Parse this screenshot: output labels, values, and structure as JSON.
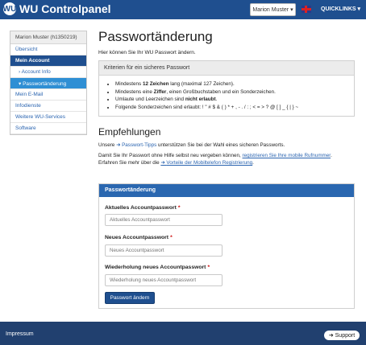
{
  "header": {
    "brand": "WU Controlpanel",
    "brand_logo": "WU",
    "user_menu": "Marion Muster ▾",
    "language_icon": "uk-flag-icon",
    "quicklinks": "QUICKLINKS ▾"
  },
  "sidebar": {
    "heading": "Marion Muster (h1350219)",
    "items": [
      {
        "label": "Übersicht"
      },
      {
        "label": "Mein Account"
      },
      {
        "label": "›  Account Info"
      },
      {
        "label": "▾  Passwortänderung"
      },
      {
        "label": "Mein E-Mail"
      },
      {
        "label": "Infodienste"
      },
      {
        "label": "Weitere WU-Services"
      },
      {
        "label": "Software"
      }
    ]
  },
  "main": {
    "title": "Passwortänderung",
    "intro": "Hier können Sie Ihr WU Passwort ändern.",
    "criteria": {
      "heading": "Kriterien für ein sicheres Passwort",
      "items": [
        {
          "pre": "Mindestens ",
          "bold": "12 Zeichen",
          "post": " lang (maximal 127 Zeichen)."
        },
        {
          "pre": "Mindestens eine ",
          "bold": "Ziffer",
          "post": ", einen Großbuchstaben und ein Sonderzeichen."
        },
        {
          "pre": "Umlaute und Leerzeichen sind ",
          "bold": "nicht erlaubt",
          "post": "."
        },
        {
          "pre": "Folgende Sonderzeichen sind erlaubt: ! \" # $ & ( ) * + , - . / : ; < = > ? @ [ ] _ { | } ~",
          "bold": "",
          "post": ""
        }
      ]
    },
    "recommendations": {
      "heading": "Empfehlungen",
      "p1_pre": "Unsere ",
      "p1_link": "Passwort-Tipps",
      "p1_post": " unterstützen Sie bei der Wahl eines sicheren Passworts.",
      "p2_pre": "Damit Sie Ihr Passwort ohne Hilfe selbst neu vergeben können, ",
      "p2_link": "registrieren Sie Ihre mobile Rufnummer",
      "p2_post": ".",
      "p3_pre": "Erfahren Sie mehr über die ",
      "p3_link": "Vorteile der Mobiltelefon Registrierung",
      "p3_post": "."
    },
    "form": {
      "heading": "Passwortänderung",
      "current_label": "Aktuelles Accountpasswort",
      "current_placeholder": "Aktuelles Accountpasswort",
      "new_label": "Neues Accountpasswort",
      "new_placeholder": "Neues Accountpasswort",
      "repeat_label": "Wiederholung neues Accountpasswort",
      "repeat_placeholder": "Wiederholung neues Accountpasswort",
      "required_mark": "*",
      "submit": "Passwort ändern"
    }
  },
  "footer": {
    "impressum": "Impressum",
    "support": "Support"
  }
}
